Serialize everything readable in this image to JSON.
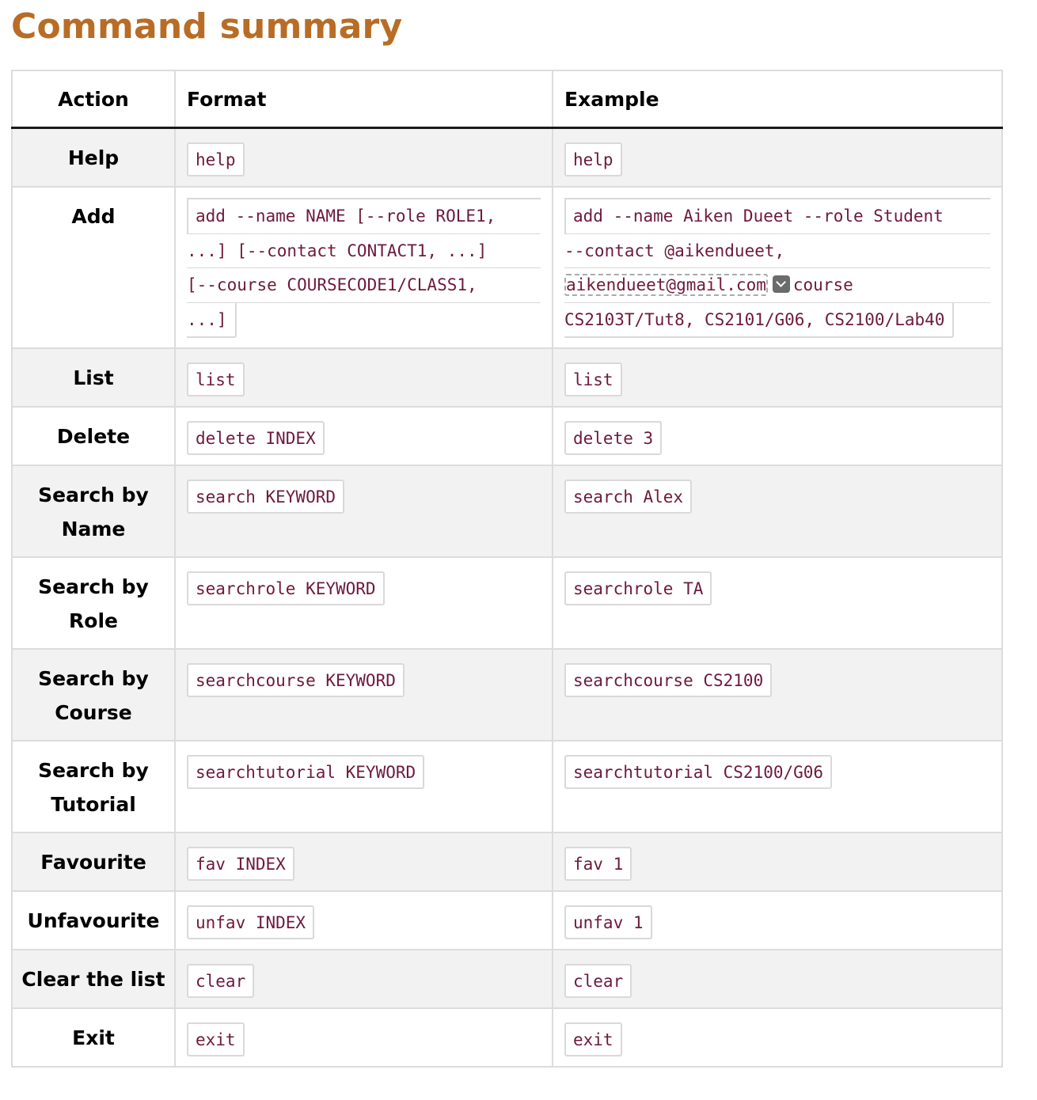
{
  "title": "Command summary",
  "headers": {
    "action": "Action",
    "format": "Format",
    "example": "Example"
  },
  "rows": [
    {
      "action": "Help",
      "format": "help",
      "example": "help"
    },
    {
      "action": "Add",
      "format_lines": [
        "add --name NAME [--role ROLE1,",
        "...] [--contact CONTACT1, ...]",
        "[--course COURSECODE1/CLASS1,",
        "...]"
      ],
      "example_lines": [
        "add --name Aiken Dueet --role Student",
        "--contact @aikendueet,",
        "aikendueet@gmail.com",
        "course",
        "CS2103T/Tut8, CS2101/G06, CS2100/Lab40"
      ]
    },
    {
      "action": "List",
      "format": "list",
      "example": "list"
    },
    {
      "action": "Delete",
      "format": "delete INDEX",
      "example": "delete 3"
    },
    {
      "action_lines": [
        "Search by",
        "Name"
      ],
      "format": "search KEYWORD",
      "example": "search Alex"
    },
    {
      "action_lines": [
        "Search by",
        "Role"
      ],
      "format": "searchrole KEYWORD",
      "example": "searchrole TA"
    },
    {
      "action_lines": [
        "Search by",
        "Course"
      ],
      "format": "searchcourse KEYWORD",
      "example": "searchcourse CS2100"
    },
    {
      "action_lines": [
        "Search by",
        "Tutorial"
      ],
      "format": "searchtutorial KEYWORD",
      "example": "searchtutorial CS2100/G06"
    },
    {
      "action": "Favourite",
      "format": "fav INDEX",
      "example": "fav 1"
    },
    {
      "action": "Unfavourite",
      "format": "unfav INDEX",
      "example": "unfav 1"
    },
    {
      "action": "Clear the list",
      "format": "clear",
      "example": "clear"
    },
    {
      "action": "Exit",
      "format": "exit",
      "example": "exit"
    }
  ],
  "icons": {
    "expand": "chevron-down-icon"
  }
}
